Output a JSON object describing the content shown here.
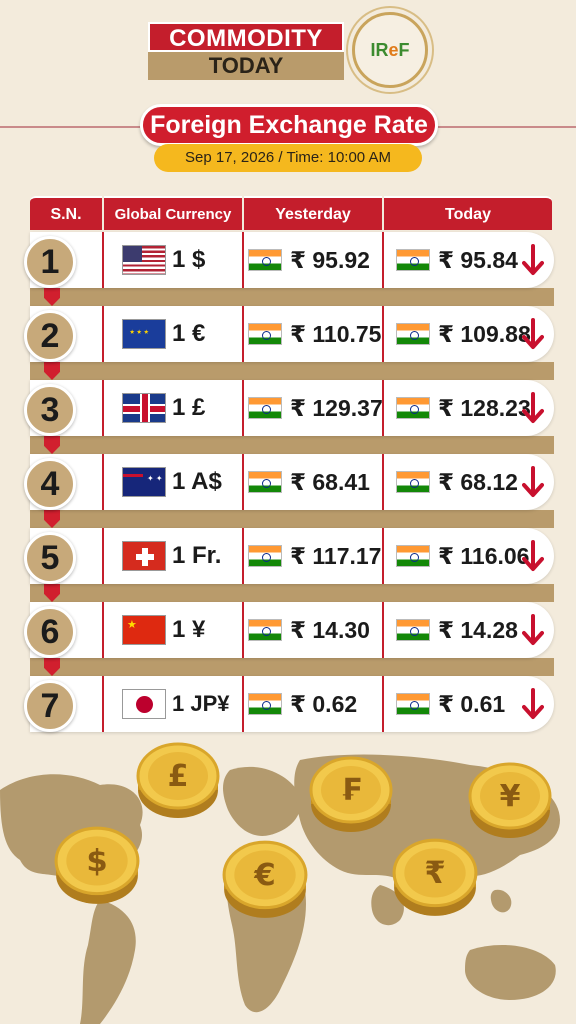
{
  "header": {
    "logo_line1": "COMMODITY",
    "logo_line2": "TODAY",
    "badge_prefix": "IR",
    "badge_mid": "e",
    "badge_suffix": "F",
    "title": "Foreign Exchange Rate",
    "date_time": "Sep 17, 2026 / Time: 10:00 AM"
  },
  "table": {
    "columns": [
      "S.N.",
      "Global Currency",
      "Yesterday",
      "Today"
    ],
    "rows": [
      {
        "sn": "1",
        "flag": "us-flag-icon",
        "currency": "1 $",
        "yesterday": "₹ 95.92",
        "today": "₹ 95.84",
        "trend": "down"
      },
      {
        "sn": "2",
        "flag": "eu-flag-icon",
        "currency": "1 €",
        "yesterday": "₹ 110.75",
        "today": "₹ 109.88",
        "trend": "down"
      },
      {
        "sn": "3",
        "flag": "uk-flag-icon",
        "currency": "1 £",
        "yesterday": "₹ 129.37",
        "today": "₹ 128.23",
        "trend": "down"
      },
      {
        "sn": "4",
        "flag": "au-flag-icon",
        "currency": "1 A$",
        "yesterday": "₹ 68.41",
        "today": "₹ 68.12",
        "trend": "down"
      },
      {
        "sn": "5",
        "flag": "ch-flag-icon",
        "currency": "1 Fr.",
        "yesterday": "₹ 117.17",
        "today": "₹ 116.06",
        "trend": "down"
      },
      {
        "sn": "6",
        "flag": "cn-flag-icon",
        "currency": "1 ¥",
        "yesterday": "₹ 14.30",
        "today": "₹ 14.28",
        "trend": "down"
      },
      {
        "sn": "7",
        "flag": "jp-flag-icon",
        "currency": "1 JP¥",
        "yesterday": "₹ 0.62",
        "today": "₹ 0.61",
        "trend": "down"
      }
    ]
  },
  "coins": [
    "£",
    "₣",
    "¥",
    "$",
    "€",
    "₹"
  ],
  "colors": {
    "brand_red": "#c41e2c",
    "gold": "#b99b6b",
    "pill_yellow": "#f5b81e",
    "down_arrow": "#c8102e",
    "background": "#f3ebdc"
  }
}
